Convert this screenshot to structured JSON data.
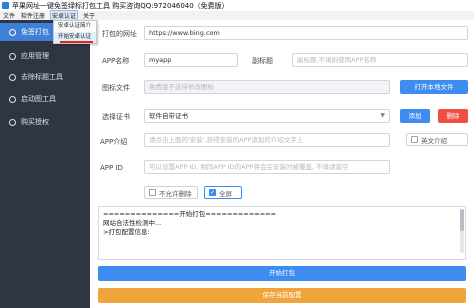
{
  "titlebar": {
    "title": "苹果网址一键免签绿标打包工具 购买咨询QQ:972046040（免费版）"
  },
  "menubar": {
    "items": [
      "文件",
      "软件注册",
      "安卓认证",
      "关于"
    ]
  },
  "dropdown": {
    "items": [
      "安卓认证简介",
      "开始安卓认证"
    ]
  },
  "sidebar": {
    "items": [
      {
        "label": "免签打包",
        "active": true
      },
      {
        "label": "应用管理",
        "active": false
      },
      {
        "label": "去除标题工具",
        "active": false
      },
      {
        "label": "启动图工具",
        "active": false
      },
      {
        "label": "购买授权",
        "active": false
      }
    ]
  },
  "form": {
    "url_label": "打包的网址",
    "url_value": "https://www.bing.com",
    "appname_label": "APP名称",
    "appname_value": "myapp",
    "subtitle_label": "副标题",
    "subtitle_placeholder": "副标题,不填则使用APP名称",
    "icon_label": "图标文件",
    "icon_placeholder": "免费版不支持修改图标",
    "open_local_label": "打开本地文件",
    "cert_label": "选择证书",
    "cert_value": "软件自带证书",
    "add_label": "添加",
    "delete_label": "删除",
    "intro_label": "APP介绍",
    "intro_placeholder": "请点击上面的'安装',获得安装的APP添加的介绍文字上",
    "english_intro_label": "英文介绍",
    "appid_label": "APP ID",
    "appid_placeholder": "可以设置APP ID, 相同APP ID的APP将会在安装时被覆盖, 不填请留空",
    "no_delete_label": "不允许删除",
    "fullscreen_label": "全屏"
  },
  "log": {
    "lines": [
      "==============开始打包=============",
      "网站合法性检测中...",
      ">打包配置信息:"
    ]
  },
  "actions": {
    "pack_label": "开始打包",
    "save_label": "保存当前配置"
  },
  "colors": {
    "sidebar_bg": "#2f3541",
    "accent_blue": "#3e8cf0",
    "danger_red": "#f04f43",
    "save_orange": "#f0a53c"
  }
}
